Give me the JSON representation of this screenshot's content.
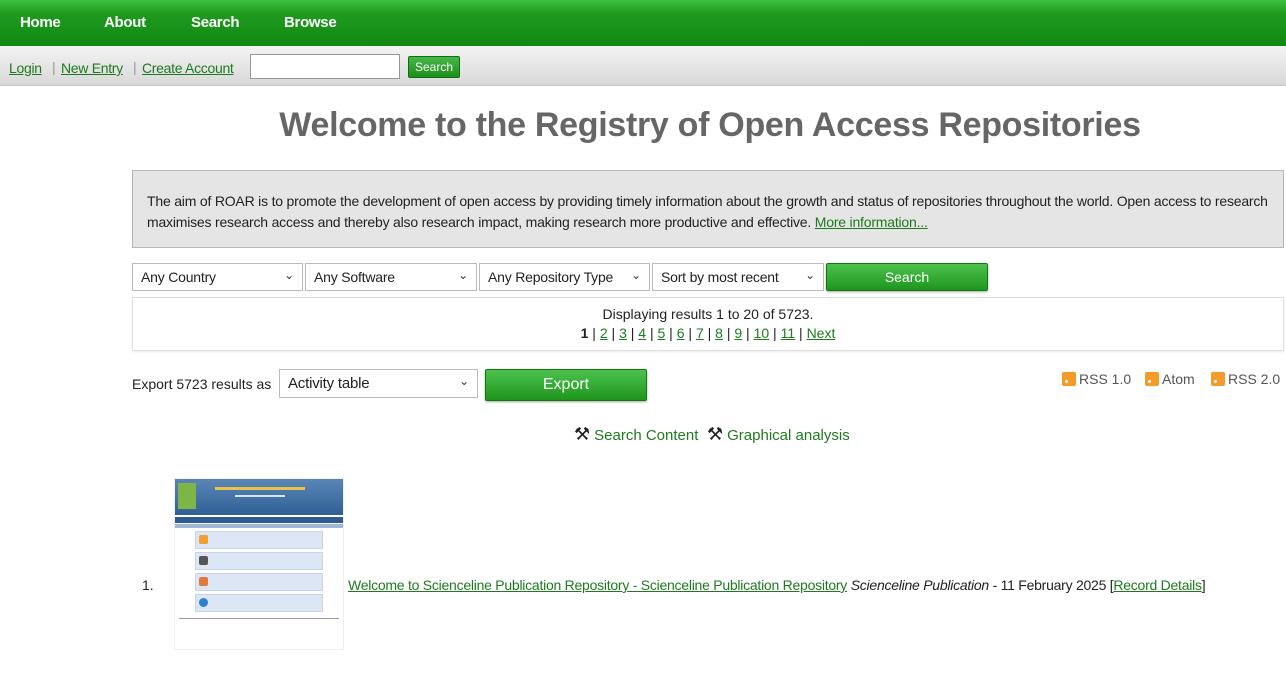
{
  "nav": {
    "home": "Home",
    "about": "About",
    "search": "Search",
    "browse": "Browse"
  },
  "loginbar": {
    "login": "Login",
    "new_entry": "New Entry",
    "create_account": "Create Account",
    "search_value": "",
    "search_button": "Search"
  },
  "page": {
    "title": "Welcome to the Registry of Open Access Repositories",
    "intro_text": "The aim of ROAR is to promote the development of open access by providing timely information about the growth and status of repositories throughout the world. Open access to research maximises research access and thereby also research impact, making research more productive and effective. ",
    "intro_link": "More information..."
  },
  "filters": {
    "country": "Any Country",
    "software": "Any Software",
    "repo_type": "Any Repository Type",
    "sort": "Sort by most recent",
    "search_button": "Search"
  },
  "results": {
    "count_text": "Displaying results 1 to 20 of 5723.",
    "current_page": "1",
    "pages": [
      "2",
      "3",
      "4",
      "5",
      "6",
      "7",
      "8",
      "9",
      "10",
      "11"
    ],
    "next": "Next"
  },
  "export": {
    "label": "Export 5723 results as",
    "format": "Activity table",
    "button": "Export"
  },
  "feeds": {
    "rss1": "RSS 1.0",
    "atom": "Atom",
    "rss2": "RSS 2.0"
  },
  "tools": {
    "search_content": "Search Content",
    "graphical_analysis": "Graphical analysis"
  },
  "records": [
    {
      "number": "1.",
      "title": "Welcome to Scienceline Publication Repository - Scienceline Publication Repository",
      "publisher": "Scienceline Publication",
      "date": " - 11 February 2025 [",
      "details": "Record Details",
      "close": "]"
    }
  ],
  "colors": {
    "nav_green": "#118811",
    "link_green": "#1e7a1e",
    "feed_orange": "#f39a2b"
  }
}
